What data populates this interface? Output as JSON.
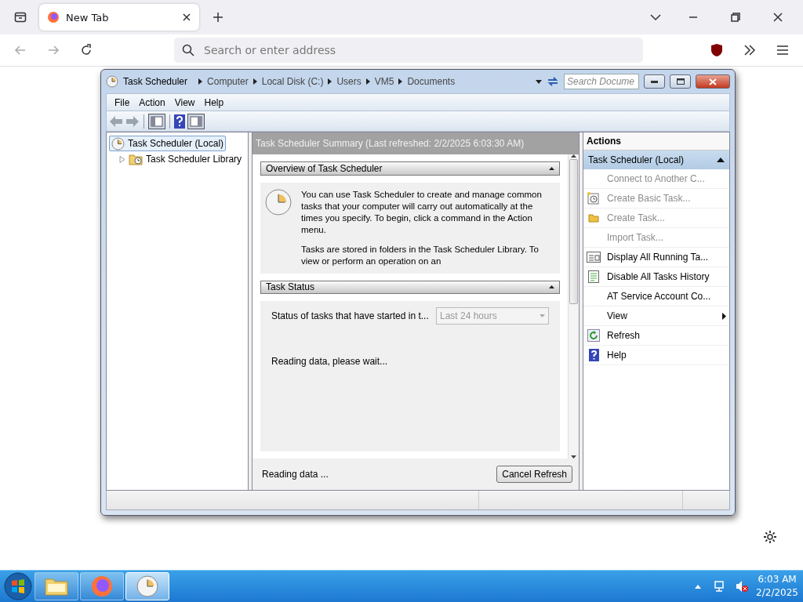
{
  "browser": {
    "tab": {
      "title": "New Tab",
      "selected": true
    },
    "address": {
      "placeholder": "Search or enter address"
    }
  },
  "window": {
    "title": "Task Scheduler",
    "breadcrumbs": [
      "Computer",
      "Local Disk (C:)",
      "Users",
      "VM5",
      "Documents"
    ],
    "search": {
      "placeholder": "Search Docume"
    },
    "menu": [
      "File",
      "Action",
      "View",
      "Help"
    ],
    "tree": [
      {
        "label": "Task Scheduler (Local)",
        "selected": true,
        "children": [
          {
            "label": "Task Scheduler Library",
            "selected": false,
            "expanded": false
          }
        ]
      }
    ],
    "summary_title": "Task Scheduler Summary (Last refreshed: 2/2/2025 6:03:30 AM)",
    "sections": [
      {
        "title": "Overview of Task Scheduler",
        "expanded": true,
        "kind": "text",
        "paragraphs": [
          "You can use Task Scheduler to create and manage common tasks that your computer will carry out automatically at the times you specify. To begin, click a command in the Action menu.",
          "Tasks are stored in folders in the Task Scheduler Library. To view or perform an operation on an"
        ]
      },
      {
        "title": "Task Status",
        "expanded": true,
        "kind": "status",
        "filter_label": "Status of tasks that have started in t...",
        "filter": {
          "value": "Last 24 hours",
          "disabled": true
        },
        "message": "Reading data, please wait..."
      }
    ],
    "footer": {
      "status": "Reading data ...",
      "button": "Cancel Refresh"
    },
    "actions": {
      "title": "Actions",
      "group": {
        "label": "Task Scheduler (Local)",
        "expanded": true
      },
      "items": [
        {
          "label": "Connect to Another C...",
          "disabled": true,
          "kind": "command"
        },
        {
          "label": "Create Basic Task...",
          "disabled": true,
          "kind": "command"
        },
        {
          "label": "Create Task...",
          "disabled": true,
          "kind": "command"
        },
        {
          "label": "Import Task...",
          "disabled": true,
          "kind": "command"
        },
        {
          "label": "Display All Running Ta...",
          "disabled": false,
          "kind": "command"
        },
        {
          "label": "Disable All Tasks History",
          "disabled": false,
          "kind": "command"
        },
        {
          "label": "AT Service Account Co...",
          "disabled": false,
          "kind": "command"
        },
        {
          "label": "View",
          "disabled": false,
          "kind": "submenu"
        },
        {
          "label": "Refresh",
          "disabled": false,
          "kind": "command"
        },
        {
          "label": "Help",
          "disabled": false,
          "kind": "command"
        }
      ]
    }
  },
  "taskbar": {
    "apps": [
      {
        "selected": false
      },
      {
        "selected": false
      },
      {
        "selected": true
      }
    ],
    "time": "6:03 AM",
    "date": "2/2/2025"
  }
}
